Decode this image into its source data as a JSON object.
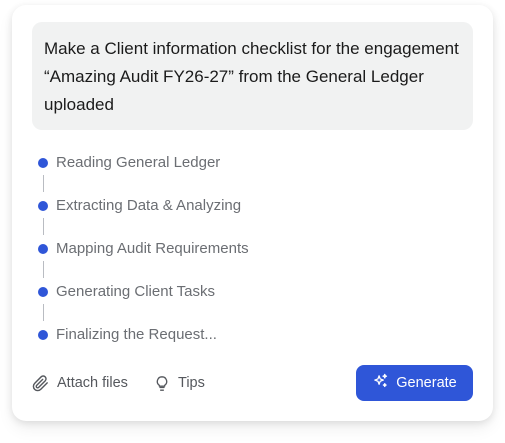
{
  "prompt": {
    "text": "Make a Client information checklist for the engagement “Amazing Audit FY26-27” from the General Ledger uploaded"
  },
  "steps": [
    {
      "label": "Reading General Ledger"
    },
    {
      "label": "Extracting Data & Analyzing"
    },
    {
      "label": "Mapping Audit Requirements"
    },
    {
      "label": "Generating Client Tasks"
    },
    {
      "label": "Finalizing the Request..."
    }
  ],
  "toolbar": {
    "attach_label": "Attach files",
    "attach_icon": "paperclip-icon",
    "tips_label": "Tips",
    "tips_icon": "lightbulb-icon",
    "generate_label": "Generate",
    "generate_icon": "sparkle-icon"
  },
  "colors": {
    "accent": "#2f56d8",
    "prompt_bg": "#f1f2f2",
    "step_text": "#6b6e73"
  }
}
